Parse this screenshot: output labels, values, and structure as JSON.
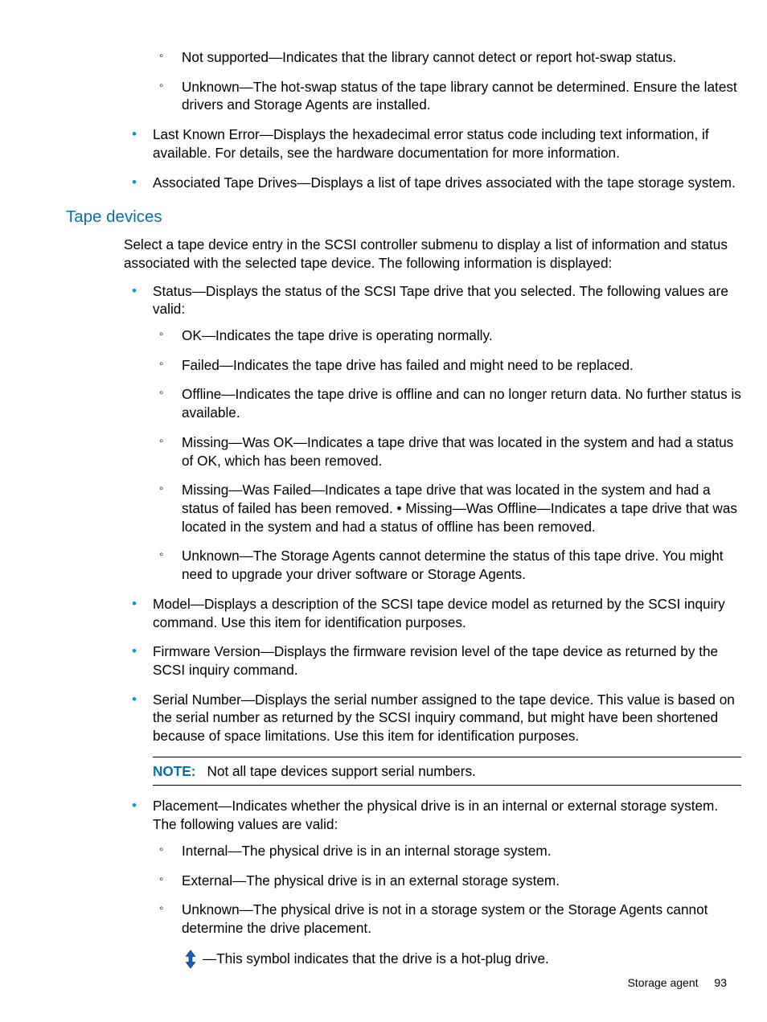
{
  "top_section": {
    "sub_items": [
      "Not supported—Indicates that the library cannot detect or report hot-swap status.",
      "Unknown—The hot-swap status of the tape library cannot be determined. Ensure the latest drivers and Storage Agents are installed."
    ],
    "bullets": [
      "Last Known Error—Displays the hexadecimal error status code including text information, if available. For details, see the hardware documentation for more information.",
      "Associated Tape Drives—Displays a list of tape drives associated with the tape storage system."
    ]
  },
  "section_heading": "Tape devices",
  "intro_para": "Select a tape device entry in the SCSI controller submenu to display a list of information and status associated with the selected tape device. The following information is displayed:",
  "status_bullet": "Status—Displays the status of the SCSI Tape drive that you selected. The following values are valid:",
  "status_sub": [
    "OK—Indicates the tape drive is operating normally.",
    "Failed—Indicates the tape drive has failed and might need to be replaced.",
    "Offline—Indicates the tape drive is offline and can no longer return data. No further status is available.",
    "Missing—Was OK—Indicates a tape drive that was located in the system and had a status of OK, which has been removed.",
    "Missing—Was Failed—Indicates a tape drive that was located in the system and had a status of failed has been removed. • Missing—Was Offline—Indicates a tape drive that was located in the system and had a status of offline has been removed.",
    "Unknown—The Storage Agents cannot determine the status of this tape drive. You might need to upgrade your driver software or Storage Agents."
  ],
  "model_bullet": "Model—Displays a description of the SCSI tape device model as returned by the SCSI inquiry command. Use this item for identification purposes.",
  "firmware_bullet": "Firmware Version—Displays the firmware revision level of the tape device as returned by the SCSI inquiry command.",
  "serial_bullet": "Serial Number—Displays the serial number assigned to the tape device. This value is based on the serial number as returned by the SCSI inquiry command, but might have been shortened because of space limitations. Use this item for identification purposes.",
  "note_label": "NOTE:",
  "note_text": "Not all tape devices support serial numbers.",
  "placement_bullet": "Placement—Indicates whether the physical drive is in an internal or external storage system. The following values are valid:",
  "placement_sub": [
    "Internal—The physical drive is in an internal storage system.",
    "External—The physical drive is in an external storage system.",
    "Unknown—The physical drive is not in a storage system or the Storage Agents cannot determine the drive placement."
  ],
  "hotplug_text": "—This symbol indicates that the drive is a hot-plug drive.",
  "footer_label": "Storage agent",
  "footer_page": "93"
}
